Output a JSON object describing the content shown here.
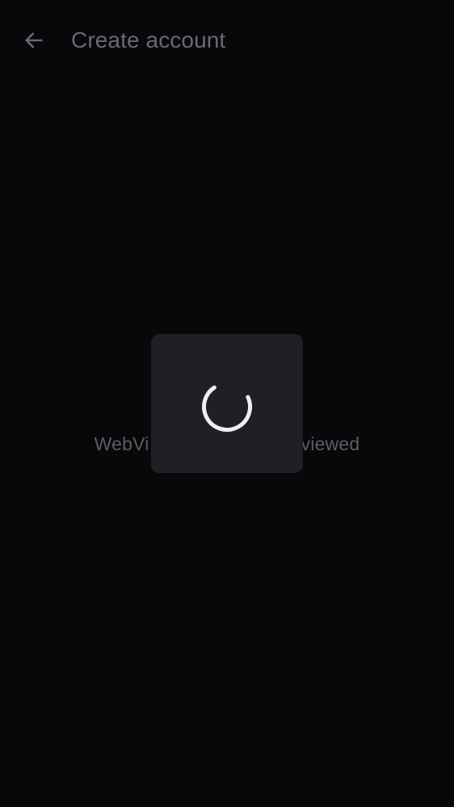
{
  "header": {
    "back_icon": "arrow-back-icon",
    "title": "Create account"
  },
  "content": {
    "webview_message_visible_left": "WebVi",
    "webview_message_visible_right": "viewed"
  },
  "loading_dialog": {
    "spinner_icon": "progress-spinner-icon"
  },
  "colors": {
    "background": "#07080a",
    "title_text": "#686a70",
    "message_text": "#5b5d62",
    "dialog_background": "#1f2024",
    "spinner": "#eceef2"
  }
}
